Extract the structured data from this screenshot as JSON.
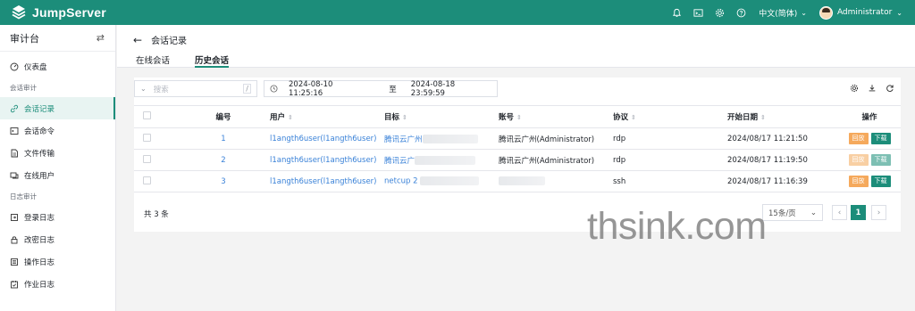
{
  "app": {
    "name": "JumpServer"
  },
  "topbar": {
    "language": "中文(简体)",
    "user": "Administrator",
    "icons": [
      "bell-icon",
      "terminal-icon",
      "settings-icon",
      "help-icon"
    ]
  },
  "sidebar": {
    "title": "审计台",
    "items_top": [
      {
        "label": "仪表盘",
        "icon": "dashboard-icon"
      }
    ],
    "group_session": "会话审计",
    "items_session": [
      {
        "label": "会话记录",
        "icon": "link-icon",
        "active": true
      },
      {
        "label": "会话命令",
        "icon": "terminal-icon"
      },
      {
        "label": "文件传输",
        "icon": "file-icon"
      },
      {
        "label": "在线用户",
        "icon": "online-user-icon"
      }
    ],
    "group_log": "日志审计",
    "items_log": [
      {
        "label": "登录日志",
        "icon": "login-icon"
      },
      {
        "label": "改密日志",
        "icon": "lock-icon"
      },
      {
        "label": "操作日志",
        "icon": "list-icon"
      },
      {
        "label": "作业日志",
        "icon": "job-icon"
      }
    ]
  },
  "header": {
    "title": "会话记录",
    "tabs": [
      {
        "label": "在线会话",
        "active": false
      },
      {
        "label": "历史会话",
        "active": true
      }
    ]
  },
  "filters": {
    "search_placeholder": "搜索",
    "search_shortcut": "/",
    "date_start": "2024-08-10 11:25:16",
    "date_separator": "至",
    "date_end": "2024-08-18 23:59:59"
  },
  "table": {
    "columns": [
      "编号",
      "用户",
      "目标",
      "账号",
      "协议",
      "开始日期",
      "操作"
    ],
    "rows": [
      {
        "id": "1",
        "user": "l1angth6user(l1angth6user)",
        "target": "腾讯云广州",
        "account": "腾讯云广州(Administrator)",
        "protocol": "rdp",
        "date": "2024/08/17 11:21:50",
        "replay": "回放",
        "download": "下载"
      },
      {
        "id": "2",
        "user": "l1angth6user(l1angth6user)",
        "target": "腾讯云广",
        "account": "腾讯云广州(Administrator)",
        "protocol": "rdp",
        "date": "2024/08/17 11:19:50",
        "replay": "回放",
        "download": "下载"
      },
      {
        "id": "3",
        "user": "l1angth6user(l1angth6user)",
        "target": "netcup 2",
        "account": "",
        "protocol": "ssh",
        "date": "2024/08/17 11:16:39",
        "replay": "回放",
        "download": "下载"
      }
    ]
  },
  "pagination": {
    "total": "共 3 条",
    "page_size": "15条/页",
    "current_page": "1"
  },
  "watermark": "thsink.com",
  "colors": {
    "brand": "#1c8d7a",
    "link": "#3a82d8",
    "replay": "#f5a95c"
  }
}
